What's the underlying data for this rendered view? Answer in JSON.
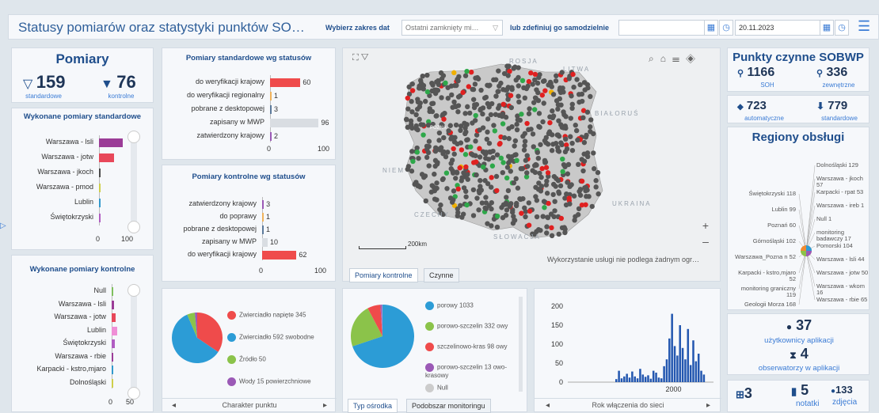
{
  "header": {
    "title": "Statusy pomiarów oraz statystyki punktów SO…",
    "range_label": "Wybierz zakres dat",
    "range_value": "Ostatni zamknięty mi…",
    "custom_label": "lub zdefiniuj go samodzielnie",
    "date_value": "20.11.2023"
  },
  "pomiary": {
    "title": "Pomiary",
    "standard_value": "159",
    "standard_label": "standardowe",
    "control_value": "76",
    "control_label": "kontrolne"
  },
  "wyk_std": {
    "title": "Wykonane pomiary standardowe",
    "rows": [
      {
        "label": "Warszawa - lsli",
        "value": 95,
        "color": "#9b3c97"
      },
      {
        "label": "Warszawa - jotw",
        "value": 60,
        "color": "#e8485a"
      },
      {
        "label": "Warszawa - jkoch",
        "value": 6,
        "color": "#4a4a4a"
      },
      {
        "label": "Warszawa - pmod",
        "value": 4,
        "color": "#cfcf4a"
      },
      {
        "label": "Lublin",
        "value": 2,
        "color": "#3399cc"
      },
      {
        "label": "Świętokrzyski",
        "value": 2,
        "color": "#b15dc2"
      }
    ],
    "ticks": [
      "0",
      "100"
    ]
  },
  "wyk_ctrl": {
    "title": "Wykonane pomiary kontrolne",
    "rows": [
      {
        "label": "Null",
        "value": 1,
        "color": "#7fbf5e"
      },
      {
        "label": "Warszawa - lsli",
        "value": 7,
        "color": "#9b3c97"
      },
      {
        "label": "Warszawa - jotw",
        "value": 12,
        "color": "#e8485a"
      },
      {
        "label": "Lublin",
        "value": 16,
        "color": "#ef8fd6"
      },
      {
        "label": "Świętokrzyski",
        "value": 8,
        "color": "#b15dc2"
      },
      {
        "label": "Warszawa - rbie",
        "value": 5,
        "color": "#9b3c97"
      },
      {
        "label": "Karpacki - kstro,mjaro",
        "value": 3,
        "color": "#3399cc"
      },
      {
        "label": "Dolnośląski",
        "value": 1,
        "color": "#cfcf4a"
      }
    ],
    "ticks": [
      "0",
      "50"
    ]
  },
  "std_status": {
    "title": "Pomiary standardowe wg statusów",
    "rows": [
      {
        "label": "do weryfikacji krajowy",
        "value": 60,
        "color": "#ef4b4b"
      },
      {
        "label": "do weryfikacji regionalny",
        "value": 1,
        "color": "#f0b25a"
      },
      {
        "label": "pobrane z desktopowej",
        "value": 3,
        "color": "#5c7a9b"
      },
      {
        "label": "zapisany w MWP",
        "value": 96,
        "color": "#d9dde2"
      },
      {
        "label": "zatwierdzony krajowy",
        "value": 2,
        "color": "#9b59b6"
      }
    ],
    "ticks": [
      "0",
      "100"
    ]
  },
  "ctrl_status": {
    "title": "Pomiary kontrolne wg statusów",
    "rows": [
      {
        "label": "zatwierdzony krajowy",
        "value": 3,
        "color": "#9b59b6"
      },
      {
        "label": "do poprawy",
        "value": 1,
        "color": "#f0b25a"
      },
      {
        "label": "pobrane z desktopowej",
        "value": 1,
        "color": "#5c7a9b"
      },
      {
        "label": "zapisany w MWP",
        "value": 10,
        "color": "#d9dde2"
      },
      {
        "label": "do weryfikacji krajowy",
        "value": 62,
        "color": "#ef4b4b"
      }
    ],
    "ticks": [
      "0",
      "100"
    ]
  },
  "map": {
    "labels": {
      "rosja": "ROSJA",
      "litwa": "LITWA",
      "bialorus": "BIAŁORUŚ",
      "ukraina": "UKRAINA",
      "czechy": "CZECHY",
      "slowacja": "SŁOWACJA",
      "niemcy": "NIEM",
      "poznan": "POZNA"
    },
    "scale": "200km",
    "attribution": "Wykorzystanie usługi nie podlega żadnym ogr…",
    "tabs": [
      "Pomiary kontrolne",
      "Czynne"
    ]
  },
  "pie1": {
    "legend": [
      {
        "label": "Zwierciadło napięte 345",
        "value": 345,
        "color": "#ef4b4b"
      },
      {
        "label": "Zwierciadło 592 swobodne",
        "value": 592,
        "color": "#2c9cd6"
      },
      {
        "label": "Źródło 50",
        "value": 50,
        "color": "#8bc34a"
      },
      {
        "label": "Wody 15 powierzchniowe",
        "value": 15,
        "color": "#9b59b6"
      }
    ],
    "footer": "Charakter punktu"
  },
  "pie2": {
    "legend": [
      {
        "label": "porowy 1033",
        "value": 1033,
        "color": "#2c9cd6"
      },
      {
        "label": "porowo-szczelin 332 owy",
        "value": 332,
        "color": "#8bc34a"
      },
      {
        "label": "szczelinowo-kras 98 owy",
        "value": 98,
        "color": "#ef4b4b"
      },
      {
        "label": "porowo-szczelin 13 owo-krasowy",
        "value": 13,
        "color": "#9b59b6"
      },
      {
        "label": "Null",
        "value": 3,
        "color": "#cccccc"
      }
    ],
    "tabs": [
      "Typ ośrodka",
      "Podobszar monitoringu"
    ]
  },
  "chart_data": {
    "type": "bar",
    "xlabel": "Rok włączenia do sieci",
    "x_tick_labels": [
      "2000"
    ],
    "ylim": [
      0,
      200
    ],
    "y_ticks": [
      0,
      50,
      100,
      150,
      200
    ],
    "x": [
      1990,
      1991,
      1992,
      1993,
      1994,
      1995,
      1996,
      1997,
      1998,
      1999,
      2000,
      2001,
      2002,
      2003,
      2004,
      2005,
      2006,
      2007,
      2008,
      2009,
      2010,
      2011,
      2012,
      2013,
      2014,
      2015,
      2016,
      2017,
      2018,
      2019,
      2020,
      2021,
      2022,
      2023
    ],
    "values": [
      8,
      30,
      10,
      15,
      22,
      12,
      28,
      15,
      10,
      35,
      20,
      14,
      18,
      9,
      30,
      25,
      12,
      10,
      42,
      60,
      115,
      180,
      95,
      70,
      150,
      90,
      60,
      140,
      45,
      110,
      55,
      75,
      30,
      20
    ]
  },
  "sobwp": {
    "title": "Punkty czynne SOBWP",
    "soh_value": "1166",
    "soh_label": "SOH",
    "ext_value": "336",
    "ext_label": "zewnętrzne",
    "auto_value": "723",
    "auto_label": "automatyczne",
    "std_value": "779",
    "std_label": "standardowe"
  },
  "regiony": {
    "title": "Regiony obsługi",
    "labels_left": [
      "Świętokrzyski 118",
      "Lublin 99",
      "Poznań 60",
      "Górnośląski 102",
      "Warszawa_Pozna n 52",
      "Karpacki - kstro,mjaro 52",
      "monitoring graniczny 119",
      "Geologii Morza 168"
    ],
    "labels_right": [
      "Dolnośląski 129",
      "Warszawa - jkoch 57",
      "Karpacki - rpat 53",
      "Warszawa - ireb 1",
      "Null 1",
      "monitoring badawczy 17",
      "Pomorski 104",
      "Warszawa - lsli 44",
      "Warszawa - jotw 50",
      "Warszawa - wkom 16",
      "Warszawa - rbie 65"
    ]
  },
  "users": {
    "users_value": "37",
    "users_label": "użytkownicy aplikacji",
    "obs_value": "4",
    "obs_label": "obserwatorzy w aplikacji"
  },
  "bottom": {
    "a_value": "3",
    "b_value": "5",
    "b_label": "notatki",
    "c_value": "133",
    "c_label": "zdjęcia"
  },
  "arrow_left": "◂",
  "arrow_right": "▸"
}
